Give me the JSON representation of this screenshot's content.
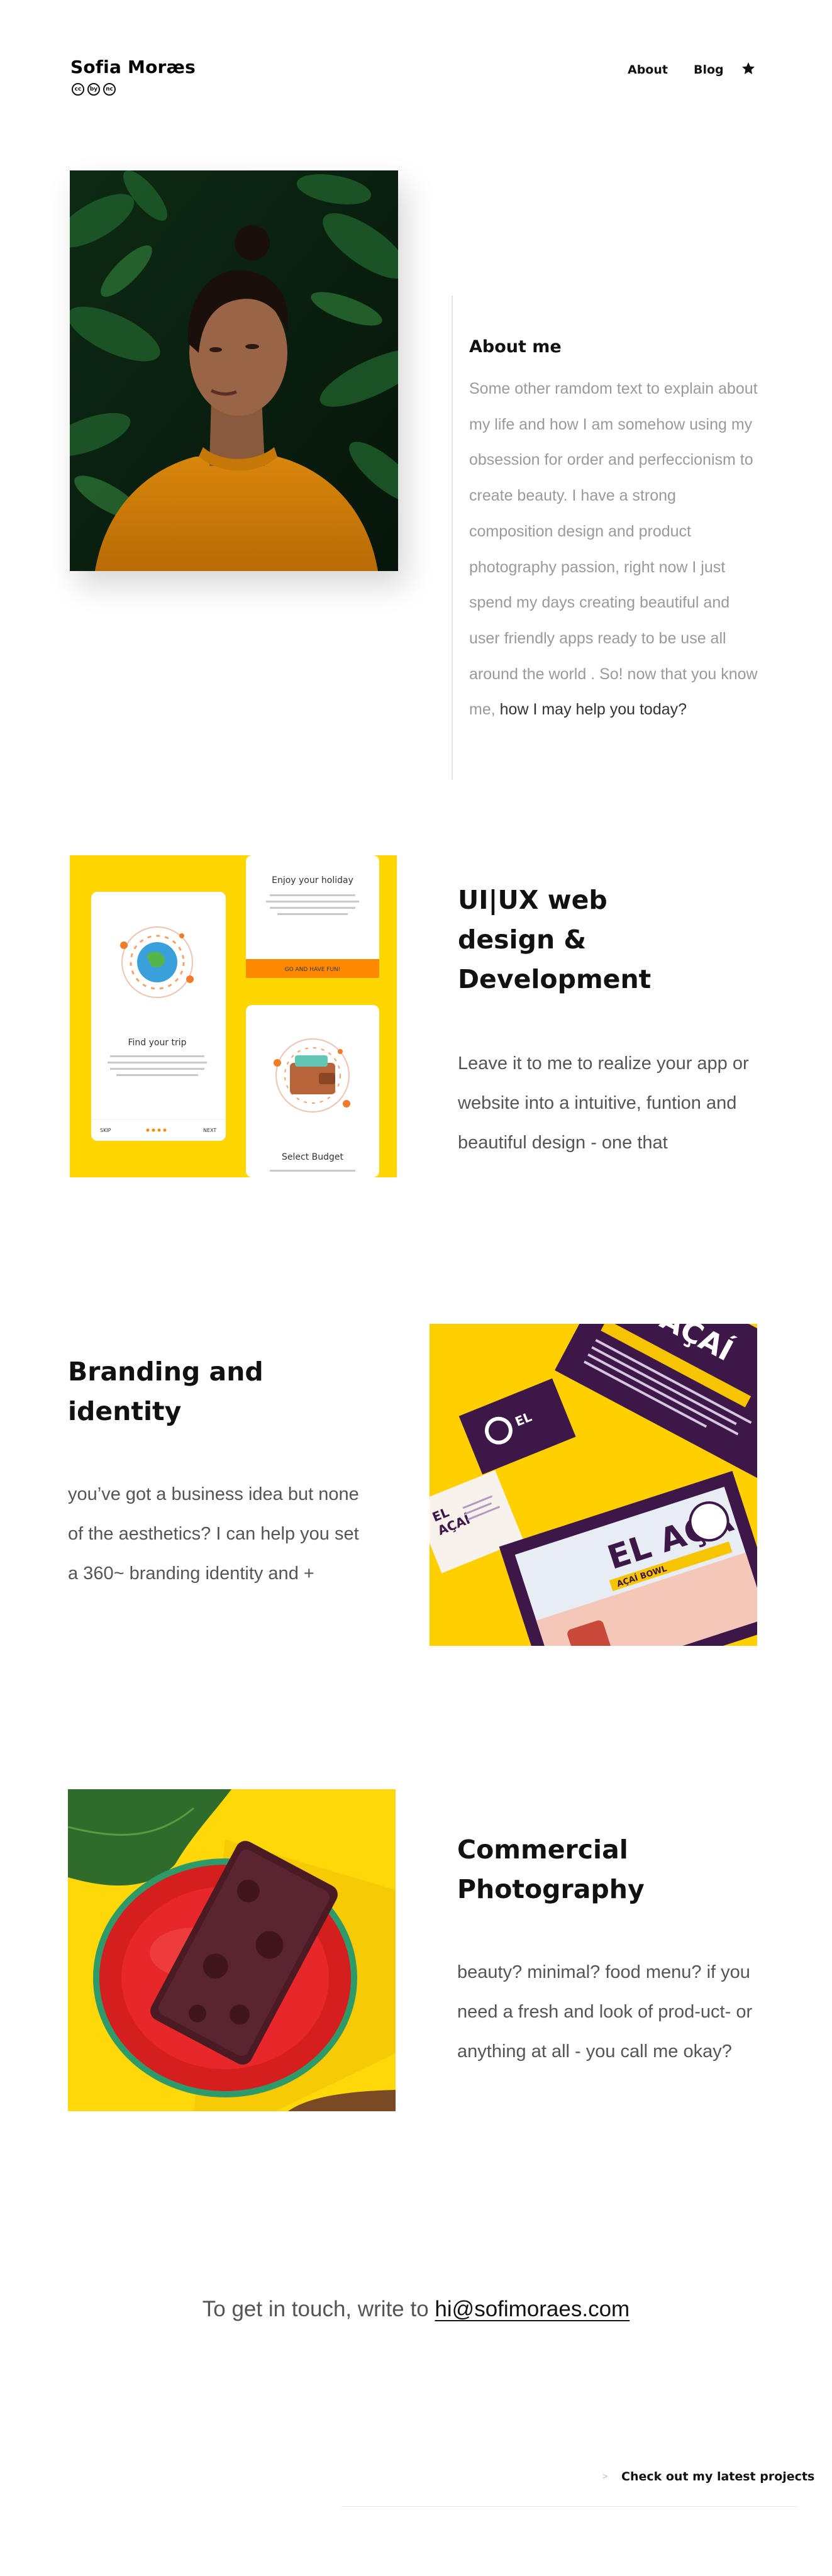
{
  "header": {
    "brand": "Sofia Moræs",
    "license_badges": [
      "cc",
      "by",
      "nc"
    ],
    "nav": {
      "about": "About",
      "blog": "Blog",
      "star_icon": "star-icon"
    }
  },
  "about": {
    "title": "About me",
    "text": "Some other ramdom text to explain about my life and how I am somehow using my obsession for order and perfeccionism to create beauty.  I have a strong composition design and product photography passion, right now I just spend my days creating beautiful and user friendly apps ready to be use all around the world . So! now that you know me,",
    "text_strong": "how I may help you today?"
  },
  "services": {
    "uiux": {
      "title": "UI|UX web design & Development",
      "body": "Leave it to me to realize your app or website into a intuitive, funtion and beautiful design - one that",
      "mockup": {
        "screen1_title": "Find your trip",
        "screen1_skip": "SKIP",
        "screen1_next": "NEXT",
        "screen2_title": "Enjoy your holiday",
        "screen2_button": "GO AND HAVE FUN!",
        "screen3_title": "Select Budget"
      }
    },
    "branding": {
      "title": "Branding and identity",
      "body": "you’ve got a business idea but none of the aesthetics? I can help you set a 360~ branding identity and +",
      "image_text": {
        "brand_name": "EL AÇAÍ",
        "tagline": "AÇAÍ BOWL"
      }
    },
    "photography": {
      "title": "Commercial Photography",
      "body": "beauty? minimal? food menu? if you need a fresh and look of prod-uct- or anything at all - you call me okay?"
    }
  },
  "contact": {
    "prefix": "To get in touch, write to",
    "email": "hi@sofimoraes.com"
  },
  "footer": {
    "arrow": ">",
    "link": "Check out my latest projects"
  },
  "colors": {
    "accent_yellow": "#ffd600",
    "accent_orange": "#ff8a00",
    "purple": "#3c1747",
    "text_gray": "#9a9a9a"
  }
}
